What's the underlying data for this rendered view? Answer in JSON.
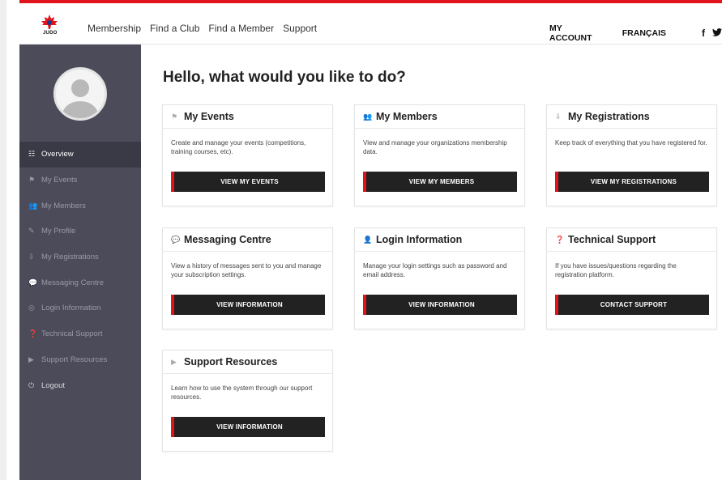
{
  "header": {
    "logo_text": "JUDO",
    "nav": [
      "Membership",
      "Find a Club",
      "Find a Member",
      "Support"
    ],
    "my_account": "MY ACCOUNT",
    "language": "FRANÇAIS",
    "social": {
      "facebook": "f",
      "twitter": "🐦"
    }
  },
  "sidebar": {
    "items": [
      {
        "label": "Overview",
        "icon": "☷"
      },
      {
        "label": "My Events",
        "icon": "⚑"
      },
      {
        "label": "My Members",
        "icon": "👥"
      },
      {
        "label": "My Profile",
        "icon": "✎"
      },
      {
        "label": "My Registrations",
        "icon": "⇩"
      },
      {
        "label": "Messaging Centre",
        "icon": "💬"
      },
      {
        "label": "Login Information",
        "icon": "◎"
      },
      {
        "label": "Technical Support",
        "icon": "❓"
      },
      {
        "label": "Support Resources",
        "icon": "▶"
      },
      {
        "label": "Logout",
        "icon": "⏻"
      }
    ]
  },
  "main": {
    "greeting": "Hello, what would you like to do?",
    "cards": [
      {
        "title": "My Events",
        "icon": "⚑",
        "desc": "Create and manage your events (competitions, training courses, etc).",
        "button": "VIEW MY EVENTS"
      },
      {
        "title": "My Members",
        "icon": "👥",
        "desc": "View and manage your organizations membership data.",
        "button": "VIEW MY MEMBERS"
      },
      {
        "title": "My Registrations",
        "icon": "⇩",
        "desc": "Keep track of everything that you have registered for.",
        "button": "VIEW MY REGISTRATIONS"
      },
      {
        "title": "Messaging Centre",
        "icon": "💬",
        "desc": "View a history of messages sent to you and manage your subscription settings.",
        "button": "VIEW INFORMATION"
      },
      {
        "title": "Login Information",
        "icon": "👤",
        "desc": "Manage your login settings such as password and email address.",
        "button": "VIEW INFORMATION"
      },
      {
        "title": "Technical Support",
        "icon": "❓",
        "desc": "If you have issues/questions regarding the registration platform.",
        "button": "CONTACT SUPPORT"
      },
      {
        "title": "Support Resources",
        "icon": "▶",
        "desc": "Learn how to use the system through our support resources.",
        "button": "VIEW INFORMATION"
      }
    ]
  },
  "colors": {
    "accent": "#e1141b",
    "sidebar": "#4b4b5a",
    "button": "#222222"
  }
}
